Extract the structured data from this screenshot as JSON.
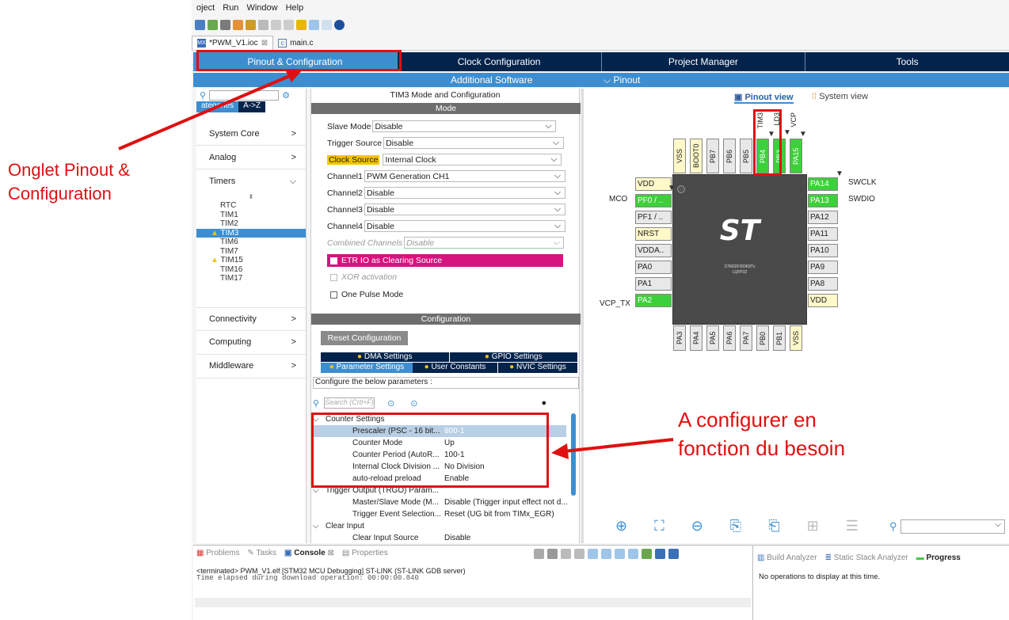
{
  "menu": {
    "items": [
      "oject",
      "Run",
      "Window",
      "Help"
    ]
  },
  "editor_tabs": [
    {
      "label": "*PWM_V1.ioc",
      "icon": "MX",
      "close": "⊠"
    },
    {
      "label": "main.c",
      "icon": "c"
    }
  ],
  "nav": {
    "tabs": [
      "Pinout & Configuration",
      "Clock Configuration",
      "Project Manager",
      "Tools"
    ],
    "additional": "Additional Software",
    "pinout": "Pinout"
  },
  "left": {
    "tab_categories": "ategories",
    "tab_az": "A->Z",
    "categories": [
      "System Core",
      "Analog",
      "Timers",
      "Connectivity",
      "Computing",
      "Middleware"
    ],
    "timers": [
      "RTC",
      "TIM1",
      "TIM2",
      "TIM3",
      "TIM6",
      "TIM7",
      "TIM15",
      "TIM16",
      "TIM17"
    ]
  },
  "mode": {
    "title": "TIM3 Mode and Configuration",
    "mode_header": "Mode",
    "slave_label": "Slave Mode",
    "slave_value": "Disable",
    "trigger_label": "Trigger Source",
    "trigger_value": "Disable",
    "clock_label": "Clock Source",
    "clock_value": "Internal Clock",
    "ch1_label": "Channel1",
    "ch1_value": "PWM Generation CH1",
    "ch2_label": "Channel2",
    "ch2_value": "Disable",
    "ch3_label": "Channel3",
    "ch3_value": "Disable",
    "ch4_label": "Channel4",
    "ch4_value": "Disable",
    "combined_label": "Combined Channels",
    "combined_value": "Disable",
    "etr": "ETR IO as Clearing Source",
    "xor": "XOR activation",
    "one_pulse": "One Pulse Mode"
  },
  "config": {
    "header": "Configuration",
    "reset": "Reset Configuration",
    "tabs_row1": [
      "DMA Settings",
      "GPIO Settings"
    ],
    "tabs_row2": [
      "Parameter Settings",
      "User Constants",
      "NVIC Settings"
    ],
    "configure_text": "Configure the below parameters :",
    "search_placeholder": "Search (Crtl+F)",
    "params": [
      {
        "label": "Counter Settings",
        "value": "",
        "type": "group"
      },
      {
        "label": "Prescaler (PSC - 16 bit...",
        "value": "800-1",
        "type": "sel"
      },
      {
        "label": "Counter Mode",
        "value": "Up",
        "type": "item"
      },
      {
        "label": "Counter Period (AutoR...",
        "value": "100-1",
        "type": "item"
      },
      {
        "label": "Internal Clock Division ...",
        "value": "No Division",
        "type": "item"
      },
      {
        "label": "auto-reload preload",
        "value": "Enable",
        "type": "item"
      },
      {
        "label": "Trigger Output (TRGO) Param...",
        "value": "",
        "type": "group"
      },
      {
        "label": "Master/Slave Mode (M...",
        "value": "Disable (Trigger input effect not d...",
        "type": "item"
      },
      {
        "label": "Trigger Event Selection...",
        "value": "Reset (UG bit from TIMx_EGR)",
        "type": "item"
      },
      {
        "label": "Clear Input",
        "value": "",
        "type": "group"
      },
      {
        "label": "Clear Input Source",
        "value": "Disable",
        "type": "item"
      }
    ]
  },
  "pinout": {
    "view_pinout": "Pinout view",
    "view_system": "System view",
    "chip_name": "STM32F303K8Tx",
    "package": "LQFP32",
    "top_labels": [
      "TIM3",
      "LD3",
      "VCP"
    ],
    "top_pins": [
      "VSS",
      "BOOT0",
      "PB7",
      "PB6",
      "PB5",
      "PB4",
      "PB3",
      "PA15"
    ],
    "left_pins": [
      "VDD",
      "PF0 / ..",
      "PF1 / ..",
      "NRST",
      "VDDA..",
      "PA0",
      "PA1",
      "PA2"
    ],
    "left_labels": [
      "MCO",
      "VCP_TX"
    ],
    "right_pins": [
      "PA14",
      "PA13",
      "PA12",
      "PA11",
      "PA10",
      "PA9",
      "PA8",
      "VDD"
    ],
    "right_labels": [
      "SWCLK",
      "SWDIO"
    ],
    "bottom_pins": [
      "PA3",
      "PA4",
      "PA5",
      "PA6",
      "PA7",
      "PB0",
      "PB1",
      "VSS"
    ]
  },
  "console": {
    "tabs": [
      "Problems",
      "Tasks",
      "Console",
      "Properties"
    ],
    "line1": "<terminated> PWM_V1.elf [STM32 MCU Debugging] ST-LINK (ST-LINK GDB server)",
    "line2": "Time elapsed during download operation: 00:00:00.840",
    "right_tabs": [
      "Build Analyzer",
      "Static Stack Analyzer",
      "Progress"
    ],
    "progress_msg": "No operations to display at this time."
  },
  "annotations": {
    "onglet_line1": "Onglet Pinout &",
    "onglet_line2": "Configuration",
    "config_line1": "A configurer en",
    "config_line2": "fonction du besoin"
  },
  "colors": {
    "nav_dark": "#03234b",
    "nav_active": "#3d8ed0",
    "pin_green": "#3dd03a",
    "annot_red": "#e01010",
    "etr_pink": "#d6137e"
  }
}
